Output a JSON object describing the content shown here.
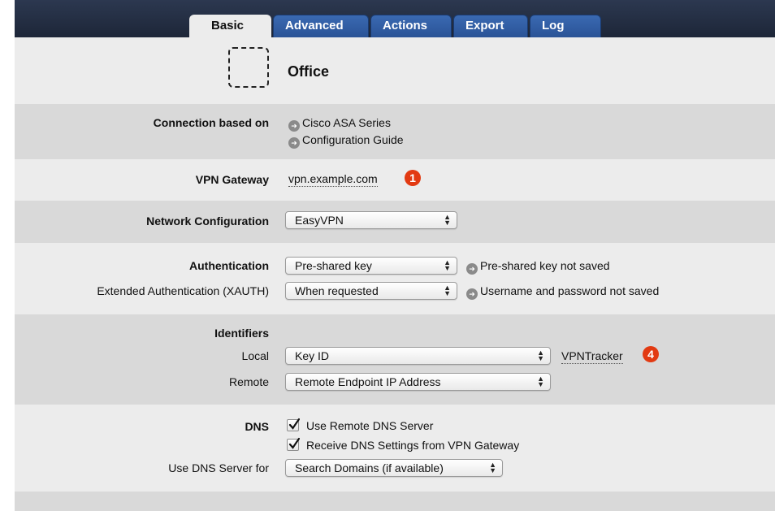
{
  "tabs": [
    {
      "label": "Basic"
    },
    {
      "label": "Advanced"
    },
    {
      "label": "Actions"
    },
    {
      "label": "Export"
    },
    {
      "label": "Log"
    }
  ],
  "header": {
    "name": "Office"
  },
  "connection": {
    "label": "Connection based on",
    "links": [
      "Cisco ASA Series",
      "Configuration Guide"
    ]
  },
  "gateway": {
    "label": "VPN Gateway",
    "value": "vpn.example.com",
    "callout": "1"
  },
  "network": {
    "label": "Network Configuration",
    "value": "EasyVPN"
  },
  "auth": {
    "label": "Authentication",
    "value": "Pre-shared key",
    "note": "Pre-shared key not saved",
    "xauth_label": "Extended Authentication (XAUTH)",
    "xauth_value": "When requested",
    "xauth_note": "Username and password not saved"
  },
  "identifiers": {
    "label": "Identifiers",
    "local_label": "Local",
    "local_value": "Key ID",
    "local_text": "VPNTracker",
    "callout": "4",
    "remote_label": "Remote",
    "remote_value": "Remote Endpoint IP Address"
  },
  "dns": {
    "label": "DNS",
    "check1": "Use Remote DNS Server",
    "check2": "Receive DNS Settings from VPN Gateway",
    "server_label": "Use DNS Server for",
    "server_value": "Search Domains (if available)"
  },
  "colors": {
    "tab_active_bg": "#ececec",
    "tab_bg": "#3a69b2",
    "callout_red": "#e23a12"
  },
  "icons": [
    "arrow-circle-icon",
    "checkbox-checked-icon",
    "popup-arrows-icon"
  ]
}
